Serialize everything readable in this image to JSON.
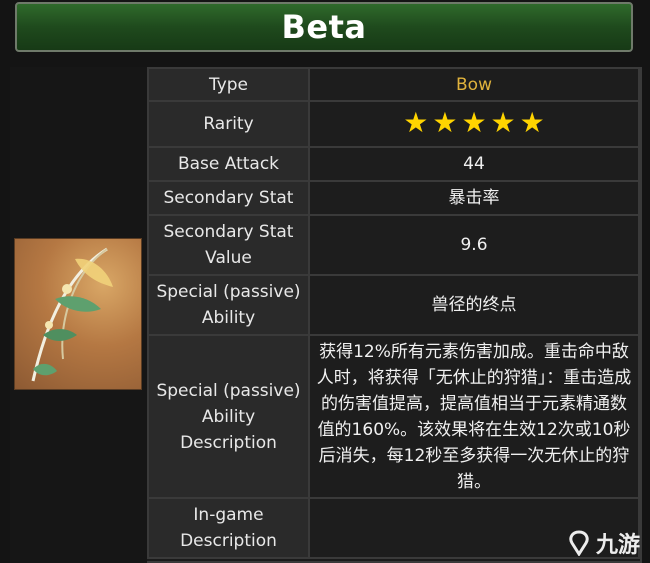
{
  "header": {
    "title": "Beta"
  },
  "weapon": {
    "type_label": "Type",
    "type_value": "Bow",
    "rarity_label": "Rarity",
    "rarity_stars": 5,
    "base_attack_label": "Base Attack",
    "base_attack_value": "44",
    "secondary_stat_label": "Secondary Stat",
    "secondary_stat_value": "暴击率",
    "secondary_stat_value_label": "Secondary Stat Value",
    "secondary_stat_value_value": "9.6",
    "ability_label": "Special (passive) Ability",
    "ability_value": "兽径的终点",
    "ability_desc_label": "Special (passive) Ability Description",
    "ability_desc_value": "获得12%所有元素伤害加成。重击命中敌人时，将获得「无休止的狩猎」：重击造成的伤害值提高，提高值相当于元素精通数值的160%。该效果将在生效12次或10秒后消失，每12秒至多获得一次无休止的狩猎。",
    "ingame_desc_label": "In-game Description",
    "ingame_desc_value": ""
  },
  "watermark": {
    "text": "九游"
  },
  "colors": {
    "title_bar": "#2a5a27",
    "bow_text": "#e0b23c",
    "star": "#ffd400",
    "label_bg": "#2a2a2a",
    "value_bg": "#1d1d1d"
  },
  "icons": {
    "rarity": "star-icon",
    "weapon": "bow-icon",
    "logo": "jiuyou-logo-icon"
  }
}
